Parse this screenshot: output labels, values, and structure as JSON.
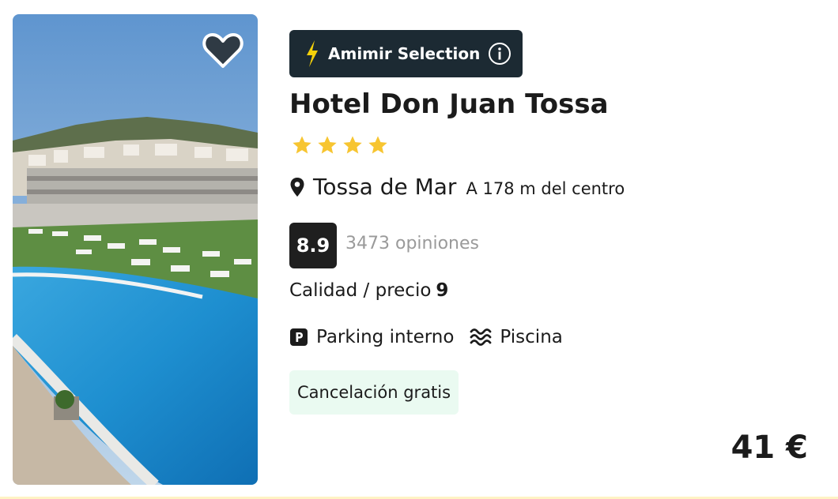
{
  "hotel": {
    "badge_label": "Amimir Selection",
    "badge_icon": "lightning-bolt-icon",
    "badge_info_icon": "info-icon",
    "name": "Hotel Don Juan Tossa",
    "stars": 4,
    "city": "Tossa de Mar",
    "distance": "A 178 m del centro",
    "score": "8.9",
    "reviews": "3473 opiniones",
    "value_label": "Calidad / precio",
    "value_score": "9",
    "amenities": [
      {
        "label": "Parking interno",
        "icon": "parking-icon"
      },
      {
        "label": "Piscina",
        "icon": "pool-waves-icon"
      }
    ],
    "cancellation": "Cancelación gratis",
    "price": "41 €",
    "favorite_icon": "heart-icon"
  },
  "colors": {
    "badge_bg": "#1c2a33",
    "bolt": "#f5d10a",
    "star": "#f7c531",
    "score_bg": "#1f1f1f",
    "cancel_bg": "#eafaf1",
    "muted_text": "#9a9a9a"
  }
}
